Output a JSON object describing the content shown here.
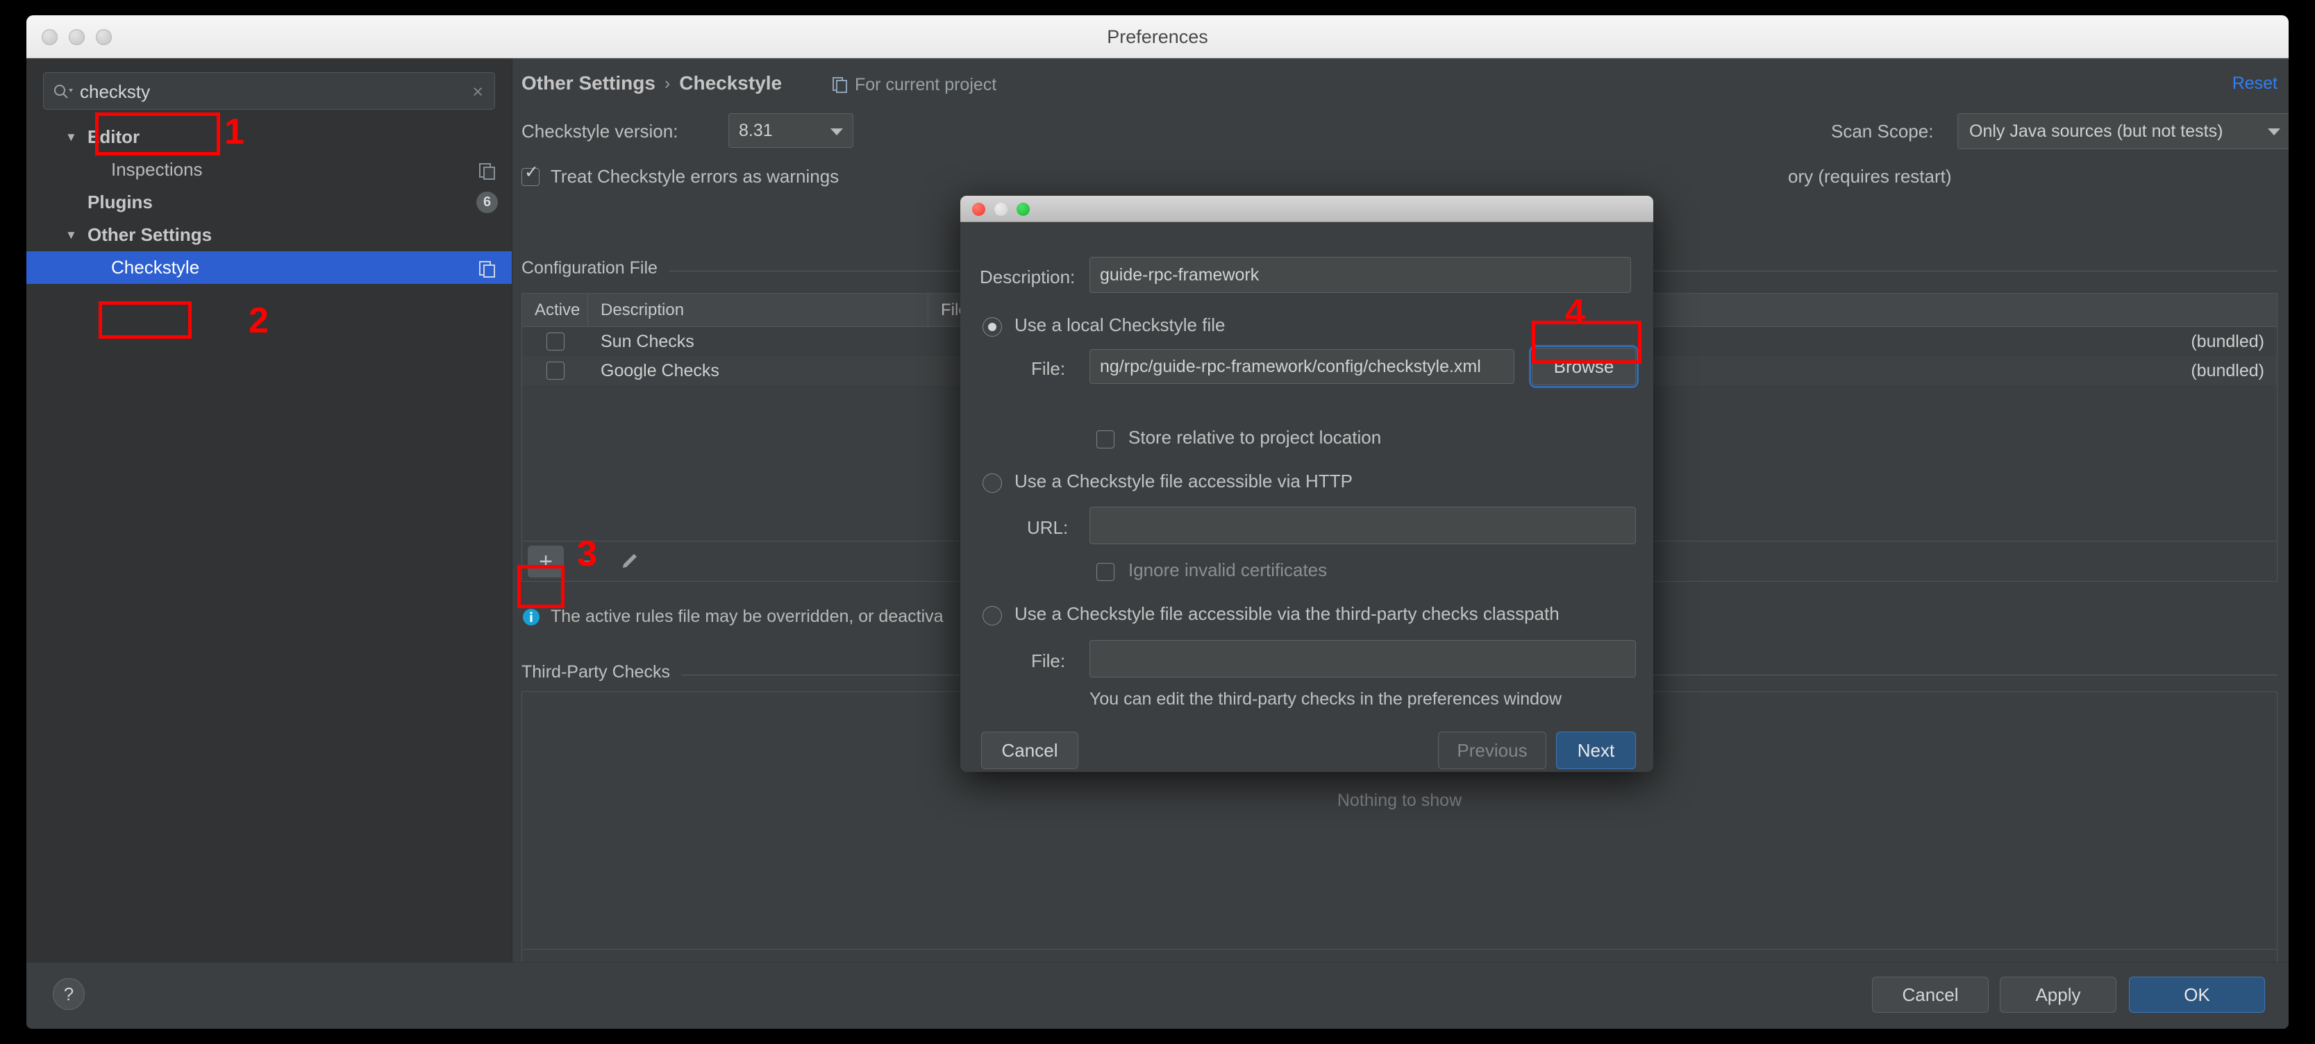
{
  "window": {
    "title": "Preferences",
    "traffic_lights": [
      "close-inactive",
      "minimize-inactive",
      "zoom-inactive"
    ]
  },
  "search": {
    "value": "checksty",
    "placeholder": "",
    "icon": "search-icon",
    "clear_icon": "clear-x-icon"
  },
  "sidebar": {
    "items": [
      {
        "label": "Editor",
        "twisty": "▼",
        "level": 0,
        "selected": false,
        "copy_icon": false,
        "badge": ""
      },
      {
        "label": "Inspections",
        "twisty": "",
        "level": 1,
        "selected": false,
        "copy_icon": true,
        "badge": ""
      },
      {
        "label": "Plugins",
        "twisty": "",
        "level": 0,
        "selected": false,
        "copy_icon": false,
        "badge": "6"
      },
      {
        "label": "Other Settings",
        "twisty": "▼",
        "level": 0,
        "selected": false,
        "copy_icon": false,
        "badge": ""
      },
      {
        "label": "Checkstyle",
        "twisty": "",
        "level": 1,
        "selected": true,
        "copy_icon": true,
        "badge": ""
      }
    ]
  },
  "main": {
    "breadcrumb": {
      "parent": "Other Settings",
      "separator": "›",
      "current": "Checkstyle"
    },
    "for_current_project": "For current project",
    "reset_link": "Reset",
    "version_label": "Checkstyle version:",
    "version_value": "8.31",
    "scan_scope_label": "Scan Scope:",
    "scan_scope_value": "Only Java sources (but not tests)",
    "treat_errors_label": "Treat Checkstyle errors as warnings",
    "treat_errors_checked": true,
    "requires_restart_label": "ory (requires restart)",
    "configuration_file_section": "Configuration File",
    "table": {
      "columns": [
        "Active",
        "Description",
        "File"
      ],
      "rows": [
        {
          "active": false,
          "description": "Sun Checks",
          "file": "(bundled)"
        },
        {
          "active": false,
          "description": "Google Checks",
          "file": "(bundled)"
        }
      ]
    },
    "toolbar": {
      "add_icon": "plus-icon",
      "remove_icon": "minus-icon",
      "edit_icon": "pencil-icon"
    },
    "info_message": "The active rules file may be overridden, or deactiva",
    "info_icon": "info-icon",
    "third_party_section": "Third-Party Checks",
    "third_party_empty": "Nothing to show",
    "third_toolbar": {
      "add_icon": "plus-icon",
      "remove_icon": "minus-icon",
      "edit_icon": "pencil-icon",
      "up_icon": "arrow-up-icon",
      "down_icon": "arrow-down-icon"
    }
  },
  "footer": {
    "help_label": "?",
    "cancel_label": "Cancel",
    "apply_label": "Apply",
    "ok_label": "OK"
  },
  "dialog": {
    "traffic_lights": [
      "close",
      "minimize",
      "zoom"
    ],
    "description_label": "Description:",
    "description_value": "guide-rpc-framework",
    "option_local": {
      "label": "Use a local Checkstyle file",
      "selected": true,
      "file_label": "File:",
      "file_value": "ng/rpc/guide-rpc-framework/config/checkstyle.xml",
      "browse_label": "Browse",
      "store_relative_label": "Store relative to project location",
      "store_relative_checked": false
    },
    "option_http": {
      "label": "Use a Checkstyle file accessible via HTTP",
      "selected": false,
      "url_label": "URL:",
      "url_value": "",
      "ignore_certs_label": "Ignore invalid certificates",
      "ignore_certs_checked": false
    },
    "option_classpath": {
      "label": "Use a Checkstyle file accessible via the third-party checks classpath",
      "selected": false,
      "file_label": "File:",
      "file_value": "",
      "hint": "You can edit the third-party checks in the preferences window"
    },
    "cancel_label": "Cancel",
    "previous_label": "Previous",
    "next_label": "Next"
  },
  "annotations": {
    "items": [
      {
        "number": "1",
        "target": "search-input"
      },
      {
        "number": "2",
        "target": "sidebar-item-checkstyle"
      },
      {
        "number": "3",
        "target": "add-configuration-button"
      },
      {
        "number": "4",
        "target": "browse-button"
      }
    ],
    "color": "#ff0000"
  },
  "colors": {
    "accent_blue": "#2d5fd1",
    "link_blue": "#2f7ff5",
    "primary_button": "#2b557f",
    "annotation_red": "#ff0000",
    "window_bg": "#3c3f41",
    "sidebar_bg": "#313335"
  }
}
